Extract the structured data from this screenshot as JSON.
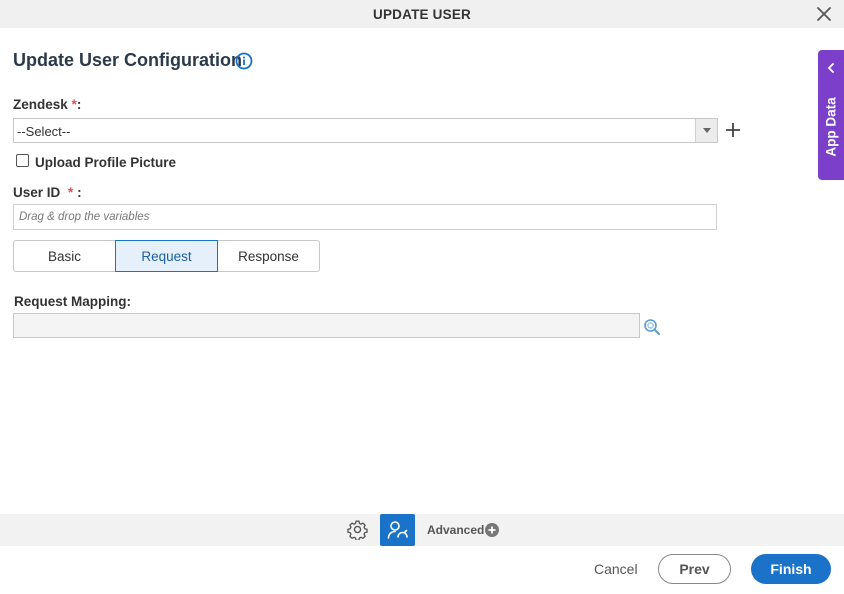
{
  "dialog": {
    "title": "UPDATE USER"
  },
  "form": {
    "heading": "Update User Configuration",
    "zendesk": {
      "label": "Zendesk",
      "required_marker": "*",
      "suffix": ":",
      "selected": "--Select--"
    },
    "upload_profile_picture": {
      "label": "Upload Profile Picture",
      "checked": false
    },
    "user_id": {
      "label": "User ID",
      "required_marker": "*",
      "suffix": " :",
      "placeholder": "Drag & drop the variables",
      "value": ""
    },
    "tabs": [
      {
        "label": "Basic",
        "active": false
      },
      {
        "label": "Request",
        "active": true
      },
      {
        "label": "Response",
        "active": false
      }
    ],
    "request_mapping": {
      "label": "Request Mapping:",
      "value": ""
    }
  },
  "side_panel": {
    "label": "App Data"
  },
  "toolbar": {
    "advanced_label": "Advanced"
  },
  "footer": {
    "cancel_label": "Cancel",
    "prev_label": "Prev",
    "finish_label": "Finish"
  },
  "colors": {
    "accent_blue": "#1a73c8",
    "app_data_purple": "#7c3fc9",
    "required_red": "#d9534f"
  }
}
